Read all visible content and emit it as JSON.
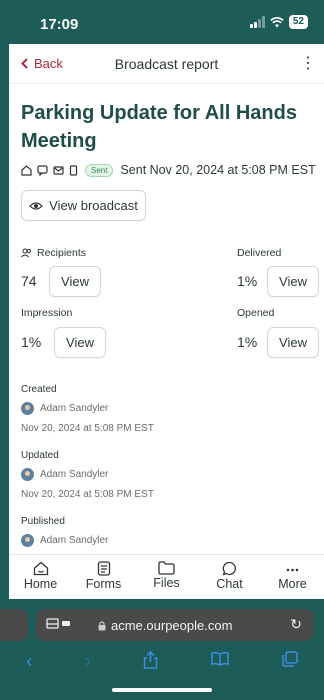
{
  "status": {
    "time": "17:09",
    "battery": "52"
  },
  "nav": {
    "back": "Back",
    "title": "Broadcast report",
    "menu": "⋮"
  },
  "broadcast": {
    "title": "Parking Update for All Hands Meeting",
    "status_badge": "Sent",
    "sent_text": "Sent Nov 20, 2024 at 5:08 PM EST",
    "view_button": "View broadcast"
  },
  "stats": {
    "recipients": {
      "label": "Recipients",
      "value": "74",
      "button": "View"
    },
    "delivered": {
      "label": "Delivered",
      "value": "1%",
      "button": "View"
    },
    "impression": {
      "label": "Impression",
      "value": "1%",
      "button": "View"
    },
    "opened": {
      "label": "Opened",
      "value": "1%",
      "button": "View"
    }
  },
  "history": {
    "created": {
      "label": "Created",
      "person": "Adam Sandyler",
      "date": "Nov 20, 2024 at 5:08 PM EST"
    },
    "updated": {
      "label": "Updated",
      "person": "Adam Sandyler",
      "date": "Nov 20, 2024 at 5:08 PM EST"
    },
    "published": {
      "label": "Published",
      "person": "Adam Sandyler"
    }
  },
  "tabs": [
    {
      "label": "Home",
      "icon": "home-icon"
    },
    {
      "label": "Forms",
      "icon": "document-icon"
    },
    {
      "label": "Files",
      "icon": "folder-icon"
    },
    {
      "label": "Chat",
      "icon": "chat-bubble-icon"
    },
    {
      "label": "More",
      "icon": "more-icon"
    }
  ],
  "browser": {
    "url": "acme.ourpeople.com"
  },
  "colors": {
    "teal": "#1d5c57",
    "accent_red": "#b3263b",
    "title_green": "#1f4d48",
    "browser_blue": "#3d8de0"
  }
}
